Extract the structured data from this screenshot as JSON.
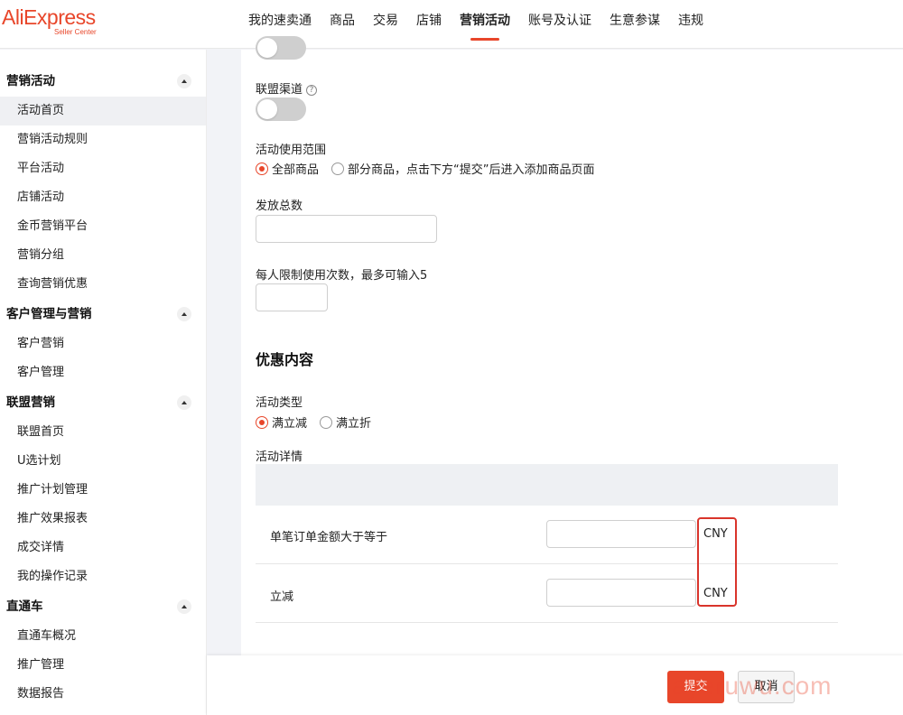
{
  "logo": {
    "main": "AliExpress",
    "sub": "Seller Center"
  },
  "nav": [
    "我的速卖通",
    "商品",
    "交易",
    "店铺",
    "营销活动",
    "账号及认证",
    "生意参谋",
    "违规"
  ],
  "nav_active_index": 4,
  "sidebar": {
    "groups": [
      {
        "title": "营销活动",
        "items": [
          "活动首页",
          "营销活动规则",
          "平台活动",
          "店铺活动",
          "金币营销平台",
          "营销分组",
          "查询营销优惠"
        ]
      },
      {
        "title": "客户管理与营销",
        "items": [
          "客户营销",
          "客户管理"
        ]
      },
      {
        "title": "联盟营销",
        "items": [
          "联盟首页",
          "U选计划",
          "推广计划管理",
          "推广效果报表",
          "成交详情",
          "我的操作记录"
        ]
      },
      {
        "title": "直通车",
        "items": [
          "直通车概况",
          "推广管理",
          "数据报告"
        ]
      }
    ],
    "active_item": "活动首页"
  },
  "form": {
    "affiliate_channel_label": "联盟渠道",
    "scope_label": "活动使用范围",
    "scope_options": [
      "全部商品",
      "部分商品，点击下方“提交”后进入添加商品页面"
    ],
    "scope_selected": "全部商品",
    "total_label": "发放总数",
    "total_value": "",
    "per_person_label": "每人限制使用次数，最多可输入5",
    "per_person_value": "",
    "discount_section_title": "优惠内容",
    "type_label": "活动类型",
    "type_options": [
      "满立减",
      "满立折"
    ],
    "type_selected": "满立减",
    "detail_label": "活动详情",
    "rows": [
      {
        "label": "单笔订单金额大于等于",
        "value": "",
        "unit": "CNY"
      },
      {
        "label": "立减",
        "value": "",
        "unit": "CNY"
      }
    ]
  },
  "footer": {
    "submit": "提交",
    "cancel": "取消"
  },
  "watermark": "a​​yeruwu.com",
  "colors": {
    "accent": "#e8462a",
    "highlight": "#d9342b"
  }
}
